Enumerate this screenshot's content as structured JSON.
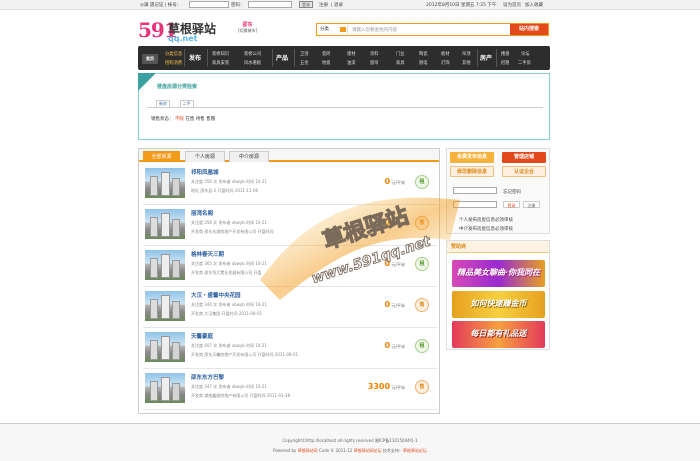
{
  "topbar": {
    "welcome": "◎满 遇记证 | 帐号：",
    "password_label": "密码：",
    "login_btn": "登录",
    "register": "注册",
    "logout": "| 退录",
    "date": "2012年8月10日 星期五 7:25 下午",
    "fav_label": "设为首页",
    "add_fav": "加入收藏"
  },
  "logo": {
    "num": "591",
    "name": "草根驿站",
    "sub": "qq.net"
  },
  "city": {
    "name": "邵东",
    "switch": "[切换城市]"
  },
  "search": {
    "category": "分类",
    "placeholder": "请输入您要查找的内容",
    "button": "站内搜索"
  },
  "nav": {
    "home": "首页",
    "sections": [
      {
        "title": "",
        "items": [
          "分类信息",
          "团购消费"
        ]
      },
      {
        "title": "发布",
        "items": [
          "装修知识",
          "家具安装"
        ]
      },
      {
        "title": "",
        "items": [
          "装修公司",
          "风水看板"
        ]
      },
      {
        "title": "产品",
        "items": [
          "卫浴",
          "五金",
          "瓷砖",
          "地板",
          "建材",
          "油漆",
          "涂料",
          "窗帘"
        ]
      },
      {
        "title": "",
        "items": [
          "门业",
          "家具",
          "陶瓷",
          "厨电",
          "板材",
          "灯饰",
          "吊顶",
          "其他"
        ]
      },
      {
        "title": "房产",
        "items": [
          "楼盘",
          "招租",
          "出租",
          "二手房"
        ]
      },
      {
        "title": "",
        "items": [
          "论坛",
          "二手房"
        ]
      }
    ],
    "sec_a": "分类信息",
    "sec_b": "团购消费"
  },
  "filter": {
    "heading": "楼盘房源分类检索",
    "tabs": [
      "新房",
      "二手"
    ],
    "row_label": "销售状态：",
    "options": [
      "不限",
      "在售",
      "待售",
      "售罄"
    ]
  },
  "list_tabs": [
    "全部房源",
    "个人房源",
    "中介房源"
  ],
  "listings": [
    {
      "title": "祁阳凤凰城",
      "meta1": "关注度 356 次 发布者 xbwyb 时间 10-21",
      "meta2": "地址 邵东县-2 开盘时间 2011-11-06",
      "price": "0",
      "unit": "元/平米",
      "badge": "租",
      "type": "z"
    },
    {
      "title": "丽湾名阁",
      "meta1": "关注度 356 次 发布者 xbwyb 时间 10-21",
      "meta2": "开发商 邵东东湖房地产开发有限公司 开盘时间",
      "price": "0",
      "unit": "元/平米",
      "badge": "售",
      "type": "s"
    },
    {
      "title": "格林春天三期",
      "meta1": "关注度 365 次 发布者 xbwyb 时间 10-21",
      "meta2": "开发商 邵东恒大置业发展有限公司 开盘",
      "price": "0",
      "unit": "元/平米",
      "badge": "租",
      "type": "z"
    },
    {
      "title": "大汉・盛馨中央花园",
      "meta1": "关注度 344 次 发布者 xbwyb 时间 10-21",
      "meta2": "开发商 大汉集团 开盘时间 2011-08-01",
      "price": "0",
      "unit": "元/平米",
      "badge": "售",
      "type": "s"
    },
    {
      "title": "天馨豪庭",
      "meta1": "关注度 407 次 发布者 xbwyb 时间 10-21",
      "meta2": "开发商 邵东天馨房地产开发有限公司 开盘时间 2011-08-01",
      "price": "0",
      "unit": "元/平米",
      "badge": "租",
      "type": "z"
    },
    {
      "title": "邵东东方巴黎",
      "meta1": "关注度 347 次 发布者 xbwyb 时间 10-21",
      "meta2": "开发商 湖南鑫顺房地产有限公司 开盘时间 2011-03-28",
      "price": "3300",
      "unit": "元/平米",
      "badge": "售",
      "type": "s"
    }
  ],
  "side": {
    "btn_free": "免费发布信息",
    "btn_manage": "管理店铺",
    "btn_edit": "修改删除信息",
    "btn_auth": "认证企业",
    "forgot": "忘记密码",
    "login": "登录",
    "register": "注册",
    "link1": "个人发布房屋信息必须审核",
    "link2": "中介发布房屋信息必须审核"
  },
  "promo": {
    "heading": "赞助商",
    "banners": [
      "精品美女聊曲·你我同在",
      "如何快速赚金币",
      "每日都有礼品送"
    ]
  },
  "watermark": {
    "line1": "草根驿站",
    "line2": "www.591qq.net"
  },
  "footer": {
    "line1": "Copyright©http://localhost all rights reserved 湘ICP备11015044号-1",
    "line2a": "Powered by ",
    "line2b": "草根驿站网",
    "line2c": " Code © 2011-12 ",
    "line2d": "草根驿站网论坛",
    "line2e": " 技术支持：",
    "line2f": "草根驿站论坛"
  },
  "colors": {
    "accent": "#f29a1a",
    "brand": "#e8327a",
    "nav": "#2d2d2d",
    "link": "#2a5ea0",
    "price": "#f08000"
  }
}
